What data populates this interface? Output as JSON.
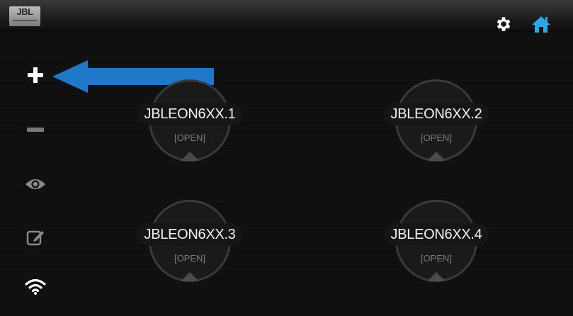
{
  "app": {
    "logo_text": "JBL"
  },
  "header": {
    "settings_icon": "gear-icon",
    "home_icon": "home-icon",
    "accent_color": "#2aa6e0"
  },
  "sidebar": {
    "items": [
      {
        "name": "add",
        "icon": "plus-icon"
      },
      {
        "name": "remove",
        "icon": "minus-icon"
      },
      {
        "name": "view",
        "icon": "eye-icon"
      },
      {
        "name": "edit",
        "icon": "edit-icon"
      },
      {
        "name": "wifi",
        "icon": "wifi-icon"
      }
    ]
  },
  "annotation": {
    "arrow_color": "#1f78c8",
    "arrow_icon": "arrow-left-icon"
  },
  "devices": [
    {
      "name": "JBLEON6XX.1",
      "status": "[OPEN]"
    },
    {
      "name": "JBLEON6XX.2",
      "status": "[OPEN]"
    },
    {
      "name": "JBLEON6XX.3",
      "status": "[OPEN]"
    },
    {
      "name": "JBLEON6XX.4",
      "status": "[OPEN]"
    }
  ]
}
